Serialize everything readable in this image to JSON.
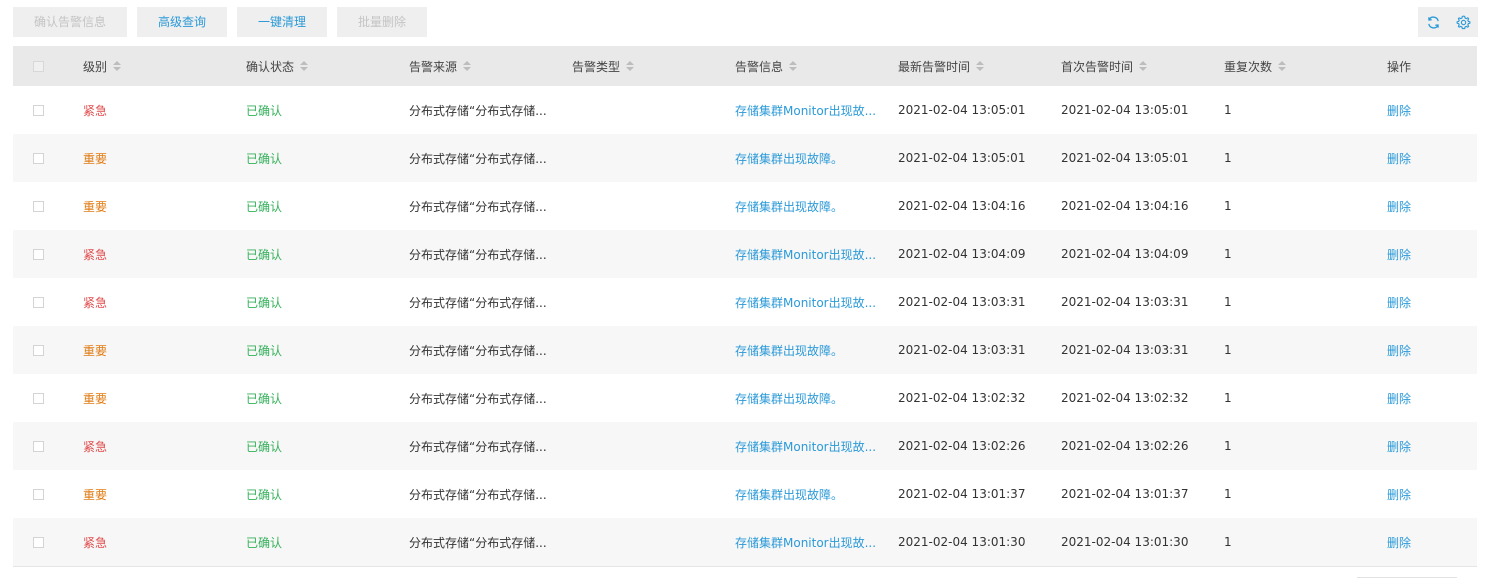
{
  "toolbar": {
    "confirm_label": "确认告警信息",
    "advanced_label": "高级查询",
    "clear_label": "一键清理",
    "batch_delete_label": "批量删除"
  },
  "colors": {
    "link": "#2b9ad8",
    "urgent": "#e04b4b",
    "important": "#e07b12",
    "confirmed": "#34b05a"
  },
  "table": {
    "headers": {
      "level": "级别",
      "status": "确认状态",
      "source": "告警来源",
      "type": "告警类型",
      "info": "告警信息",
      "latest": "最新告警时间",
      "first": "首次告警时间",
      "repeat": "重复次数",
      "op": "操作"
    },
    "rows": [
      {
        "level": "紧急",
        "severity": "urgent",
        "status": "已确认",
        "source": "分布式存储“分布式存储...",
        "type": "",
        "info": "存储集群Monitor出现故...",
        "latest": "2021-02-04 13:05:01",
        "first": "2021-02-04 13:05:01",
        "repeat": "1",
        "op": "删除"
      },
      {
        "level": "重要",
        "severity": "important",
        "status": "已确认",
        "source": "分布式存储“分布式存储...",
        "type": "",
        "info": "存储集群出现故障。",
        "latest": "2021-02-04 13:05:01",
        "first": "2021-02-04 13:05:01",
        "repeat": "1",
        "op": "删除"
      },
      {
        "level": "重要",
        "severity": "important",
        "status": "已确认",
        "source": "分布式存储“分布式存储...",
        "type": "",
        "info": "存储集群出现故障。",
        "latest": "2021-02-04 13:04:16",
        "first": "2021-02-04 13:04:16",
        "repeat": "1",
        "op": "删除"
      },
      {
        "level": "紧急",
        "severity": "urgent",
        "status": "已确认",
        "source": "分布式存储“分布式存储...",
        "type": "",
        "info": "存储集群Monitor出现故...",
        "latest": "2021-02-04 13:04:09",
        "first": "2021-02-04 13:04:09",
        "repeat": "1",
        "op": "删除"
      },
      {
        "level": "紧急",
        "severity": "urgent",
        "status": "已确认",
        "source": "分布式存储“分布式存储...",
        "type": "",
        "info": "存储集群Monitor出现故...",
        "latest": "2021-02-04 13:03:31",
        "first": "2021-02-04 13:03:31",
        "repeat": "1",
        "op": "删除"
      },
      {
        "level": "重要",
        "severity": "important",
        "status": "已确认",
        "source": "分布式存储“分布式存储...",
        "type": "",
        "info": "存储集群出现故障。",
        "latest": "2021-02-04 13:03:31",
        "first": "2021-02-04 13:03:31",
        "repeat": "1",
        "op": "删除"
      },
      {
        "level": "重要",
        "severity": "important",
        "status": "已确认",
        "source": "分布式存储“分布式存储...",
        "type": "",
        "info": "存储集群出现故障。",
        "latest": "2021-02-04 13:02:32",
        "first": "2021-02-04 13:02:32",
        "repeat": "1",
        "op": "删除"
      },
      {
        "level": "紧急",
        "severity": "urgent",
        "status": "已确认",
        "source": "分布式存储“分布式存储...",
        "type": "",
        "info": "存储集群Monitor出现故...",
        "latest": "2021-02-04 13:02:26",
        "first": "2021-02-04 13:02:26",
        "repeat": "1",
        "op": "删除"
      },
      {
        "level": "重要",
        "severity": "important",
        "status": "已确认",
        "source": "分布式存储“分布式存储...",
        "type": "",
        "info": "存储集群出现故障。",
        "latest": "2021-02-04 13:01:37",
        "first": "2021-02-04 13:01:37",
        "repeat": "1",
        "op": "删除"
      },
      {
        "level": "紧急",
        "severity": "urgent",
        "status": "已确认",
        "source": "分布式存储“分布式存储...",
        "type": "",
        "info": "存储集群Monitor出现故...",
        "latest": "2021-02-04 13:01:30",
        "first": "2021-02-04 13:01:30",
        "repeat": "1",
        "op": "删除"
      }
    ]
  }
}
